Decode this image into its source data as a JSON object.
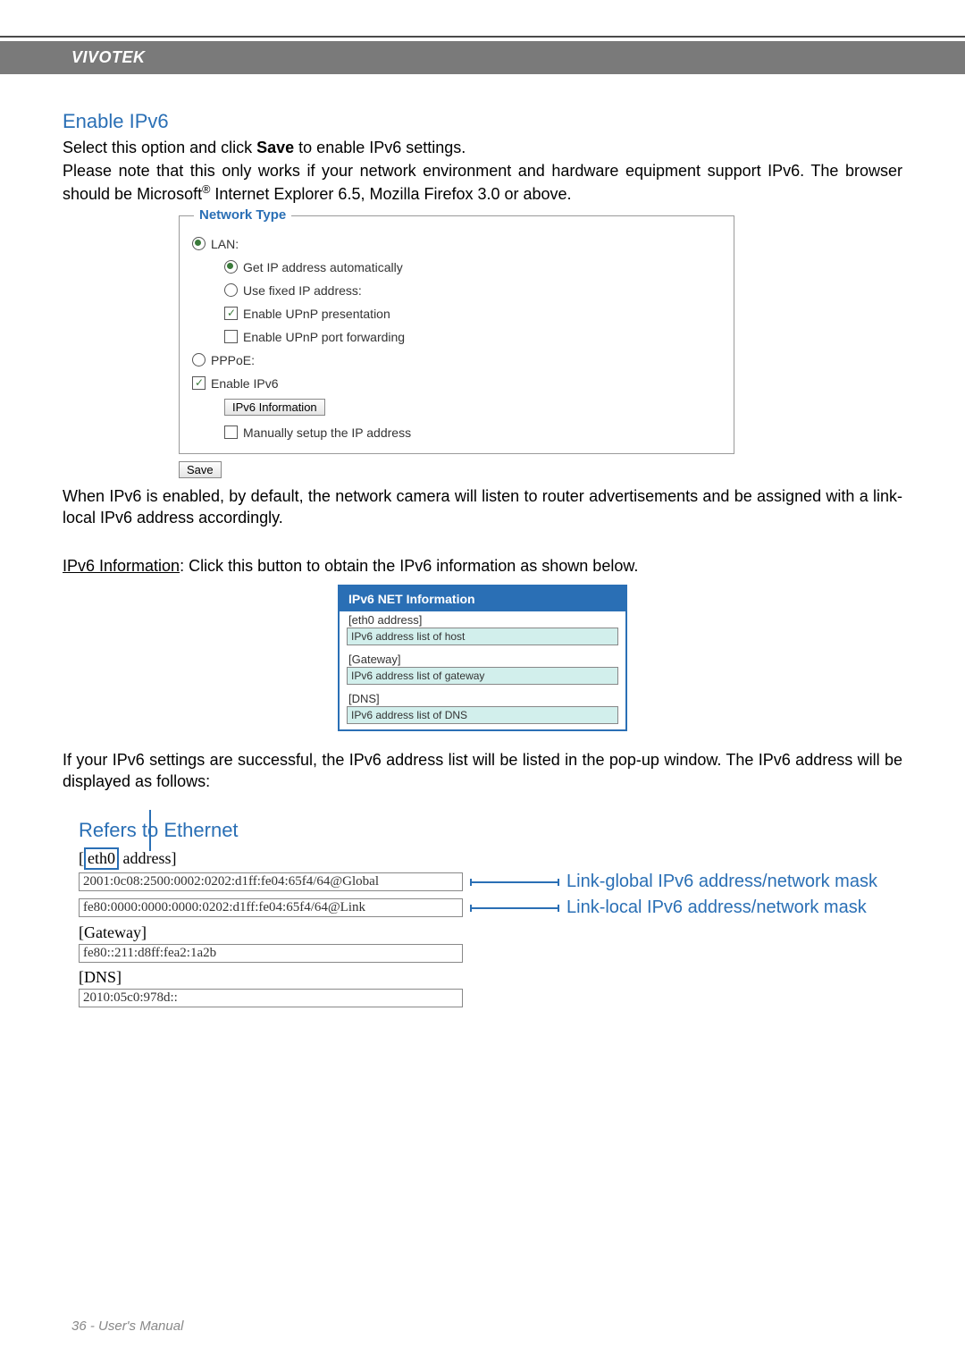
{
  "header": {
    "brand": "VIVOTEK"
  },
  "section": {
    "title": "Enable IPv6",
    "intro1_pre": "Select this option and click ",
    "intro1_bold": "Save",
    "intro1_post": " to enable IPv6 settings.",
    "intro2_pre": "Please note that this only works if your network environment and hardware equipment support IPv6. The browser should be Microsoft",
    "intro2_post": " Internet Explorer 6.5, Mozilla Firefox 3.0 or above."
  },
  "panel": {
    "legend": "Network Type",
    "rows": {
      "lan": "LAN:",
      "auto": "Get IP address automatically",
      "fixed": "Use fixed IP address:",
      "upnp_pres": "Enable UPnP presentation",
      "upnp_fwd": "Enable UPnP port forwarding",
      "pppoe": "PPPoE:",
      "enable_v6": "Enable IPv6",
      "ipv6_info_btn": "IPv6 Information",
      "manual": "Manually setup the IP address"
    },
    "save": "Save"
  },
  "after_panel": "When IPv6 is enabled, by default, the network camera will listen to router advertisements and be assigned with a link-local IPv6 address accordingly.",
  "info_line": {
    "label": "IPv6 Information",
    "rest": ": Click this button to obtain the IPv6 information as shown below."
  },
  "info_box": {
    "head": "IPv6 NET Information",
    "eth_label": "[eth0 address]",
    "eth_cell": "IPv6 address list of host",
    "gw_label": "[Gateway]",
    "gw_cell": "IPv6 address list of gateway",
    "dns_label": "[DNS]",
    "dns_cell": "IPv6 address list of DNS"
  },
  "success_text": "If your IPv6 settings are successful, the IPv6 address list will be listed in the pop-up window. The IPv6 address will be displayed as follows:",
  "refers": "Refers to Ethernet",
  "diagram": {
    "eth_pre": "[",
    "eth_boxed": "eth0",
    "eth_post": " address]",
    "row1": "2001:0c08:2500:0002:0202:d1ff:fe04:65f4/64@Global",
    "row1_anno": "Link-global IPv6 address/network mask",
    "row2": "fe80:0000:0000:0000:0202:d1ff:fe04:65f4/64@Link",
    "row2_anno": "Link-local IPv6 address/network mask",
    "gw_label": "[Gateway]",
    "gw_val": "fe80::211:d8ff:fea2:1a2b",
    "dns_label": "[DNS]",
    "dns_val": "2010:05c0:978d::"
  },
  "footer": "36 - User's Manual"
}
